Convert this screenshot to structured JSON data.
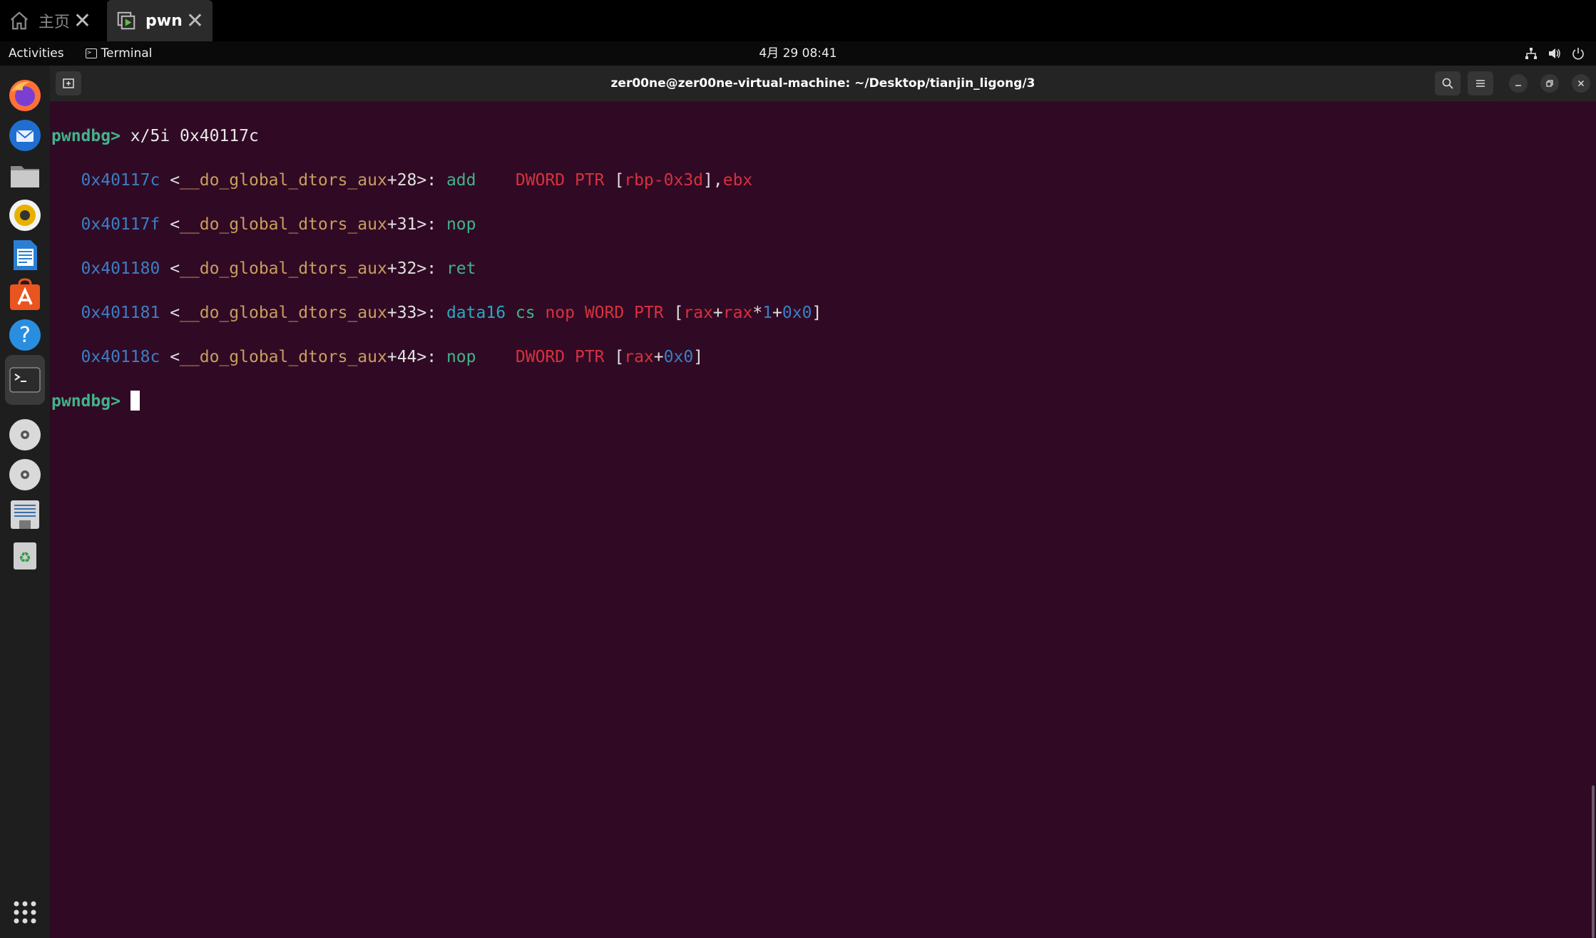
{
  "tabs": [
    {
      "label": "主页",
      "icon": "home-icon"
    },
    {
      "label": "pwn",
      "icon": "vm-icon",
      "active": true
    }
  ],
  "panel": {
    "activities": "Activities",
    "app_name": "Terminal",
    "clock": "4月 29  08:41"
  },
  "window": {
    "title": "zer00ne@zer00ne-virtual-machine: ~/Desktop/tianjin_ligong/3"
  },
  "terminal": {
    "prompt": "pwndbg>",
    "command": "x/5i 0x40117c",
    "lines": [
      {
        "addr": "0x40117c",
        "fn": "__do_global_dtors_aux",
        "off": "+28",
        "mnemonic": "add",
        "size": "DWORD PTR",
        "operand_a": "rbp-0x3d",
        "operand_b": "ebx"
      },
      {
        "addr": "0x40117f",
        "fn": "__do_global_dtors_aux",
        "off": "+31",
        "mnemonic": "nop"
      },
      {
        "addr": "0x401180",
        "fn": "__do_global_dtors_aux",
        "off": "+32",
        "mnemonic": "ret"
      },
      {
        "addr": "0x401181",
        "fn": "__do_global_dtors_aux",
        "off": "+33",
        "mnemonic": "data16",
        "prefix": "cs",
        "mn_inner": "nop",
        "size": "WORD PTR",
        "base": "rax",
        "index": "rax",
        "scale": "1",
        "disp": "0x0"
      },
      {
        "addr": "0x40118c",
        "fn": "__do_global_dtors_aux",
        "off": "+44",
        "mnemonic": "nop",
        "size": "DWORD PTR",
        "base": "rax",
        "disp": "0x0"
      }
    ]
  },
  "colors": {
    "terminal_bg": "#300a24",
    "prompt": "#41b38a",
    "address": "#3b7ec4",
    "register": "#d6313f",
    "symbol": "#c89e5e"
  }
}
